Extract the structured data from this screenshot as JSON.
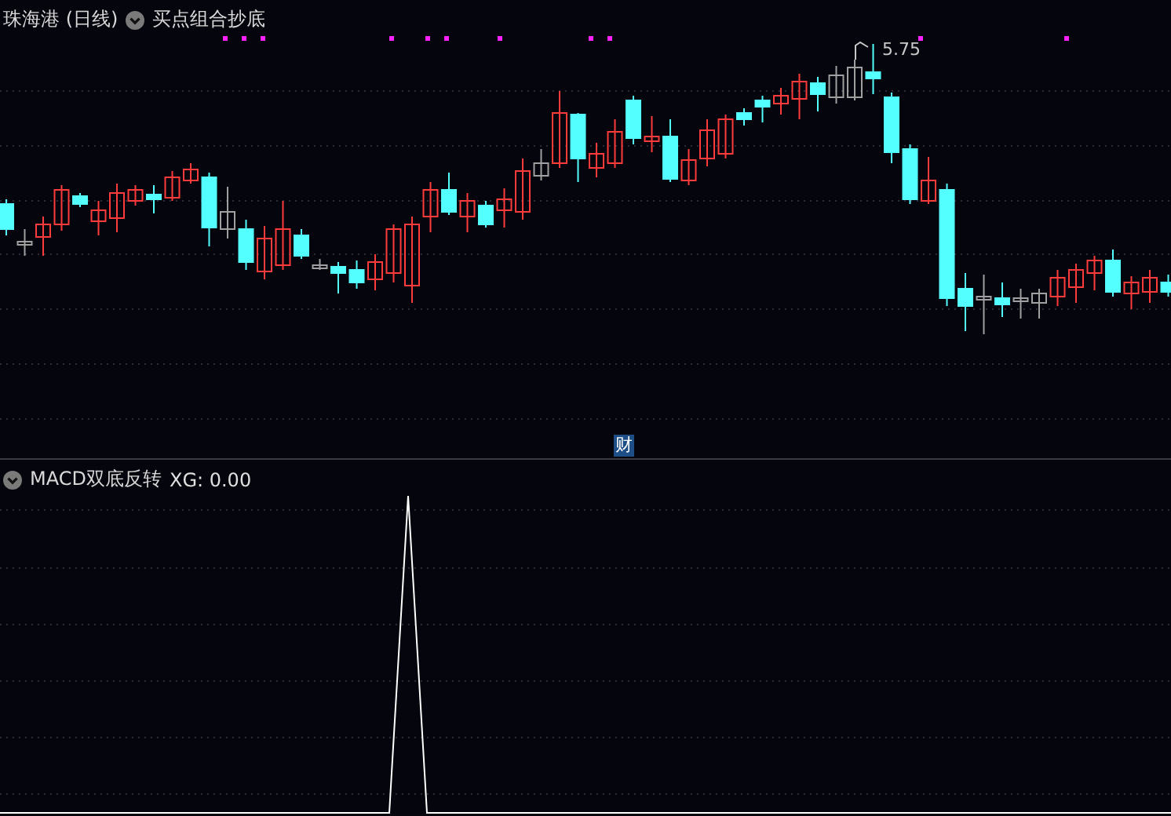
{
  "price_pane": {
    "stock_title": "珠海港 (日线)",
    "indicator_name": "买点组合抄底",
    "high_marker": "5.75",
    "badge": "财"
  },
  "indicator_pane": {
    "indicator_name": "MACD双底反转",
    "reading": "XG: 0.00"
  }
}
